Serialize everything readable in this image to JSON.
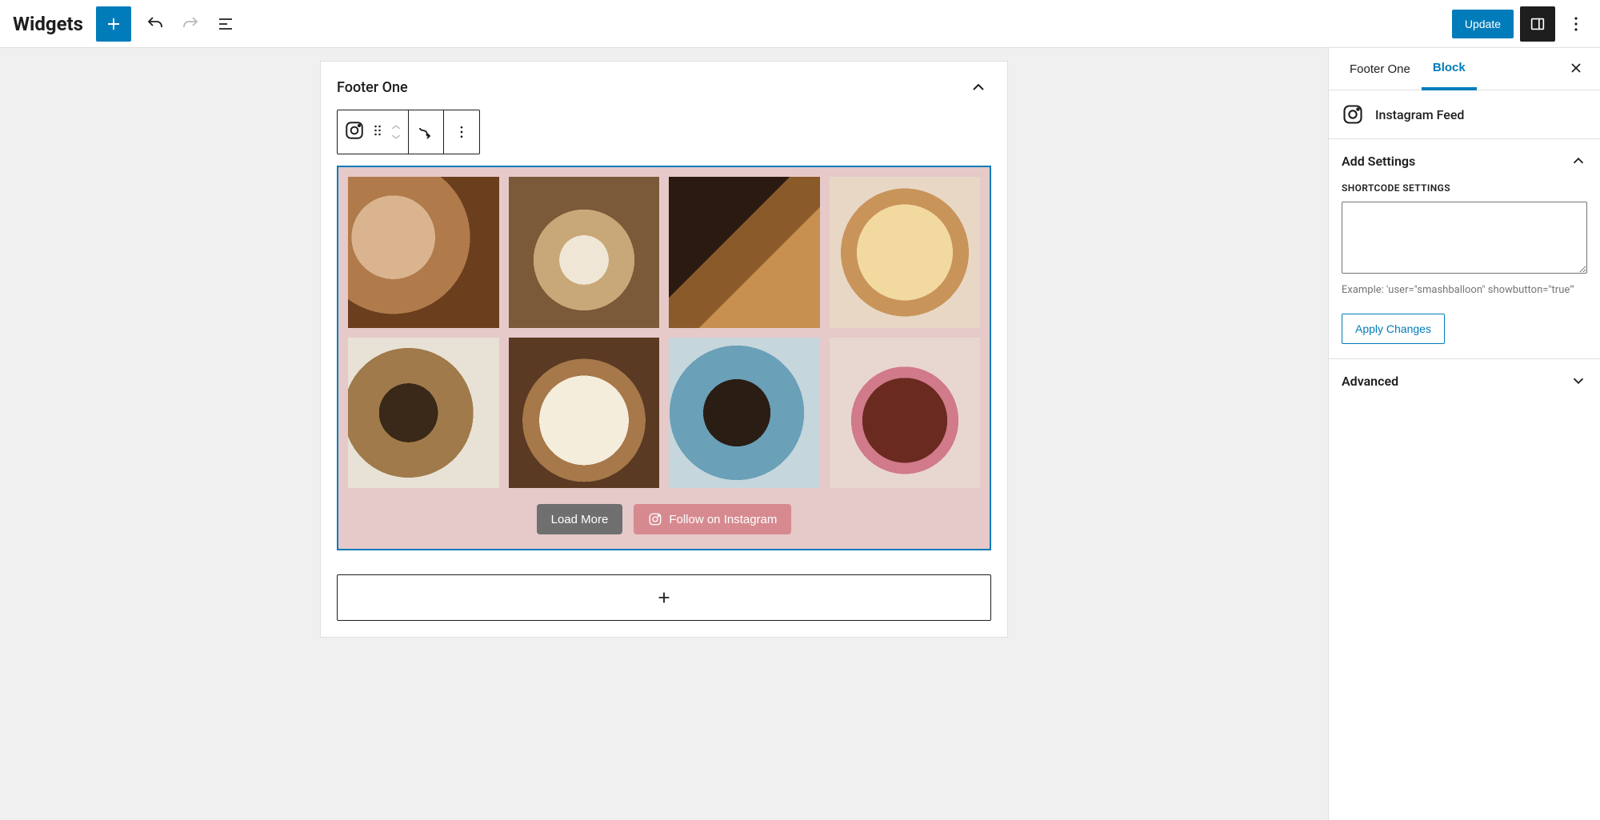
{
  "topbar": {
    "title": "Widgets",
    "update_label": "Update"
  },
  "widget_area": {
    "title": "Footer One"
  },
  "feed": {
    "load_more_label": "Load More",
    "follow_label": "Follow on Instagram"
  },
  "sidebar": {
    "tabs": {
      "area": "Footer One",
      "block": "Block"
    },
    "block_name": "Instagram Feed",
    "panels": {
      "add_settings": {
        "title": "Add Settings",
        "field_label": "SHORTCODE SETTINGS",
        "hint": "Example: 'user=\"smashballoon\" showbutton=\"true\"'",
        "apply_label": "Apply Changes"
      },
      "advanced": {
        "title": "Advanced"
      }
    }
  }
}
